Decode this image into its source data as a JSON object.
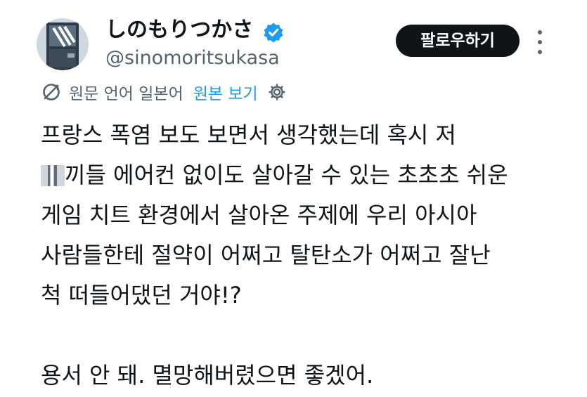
{
  "author": {
    "display_name": "しのもりつかさ",
    "handle": "@sinomoritsukasa",
    "verified": true,
    "avatar_icon": "avatar-image"
  },
  "follow_button": {
    "label": "팔로우하기"
  },
  "more_menu": {
    "icon": "more-vertical-icon"
  },
  "translation": {
    "label": "원문 언어 일본어",
    "show_original_label": "원본 보기",
    "icon": "translate-icon",
    "settings_icon": "gear-icon"
  },
  "tweet": {
    "lines": [
      "프랑스 폭염 보도 보면서 생각했는데 혹시 저",
      "끼들 에어컨 없이도 살아갈 수 있는 초초초 쉬운",
      "게임 치트 환경에서 살아온 주제에 우리 아시아",
      "사람들한테 절약이 어쩌고 탈탄소가 어쩌고 잘난",
      "척 떠들어댔던 거야!?",
      "용서 안 돼. 멸망해버렸으면 좋겠어."
    ]
  },
  "colors": {
    "text_primary": "#0f1419",
    "text_secondary": "#536471",
    "link": "#1d9bf0",
    "verified": "#1d9bf0",
    "button_bg": "#0f1419",
    "button_text": "#ffffff"
  }
}
